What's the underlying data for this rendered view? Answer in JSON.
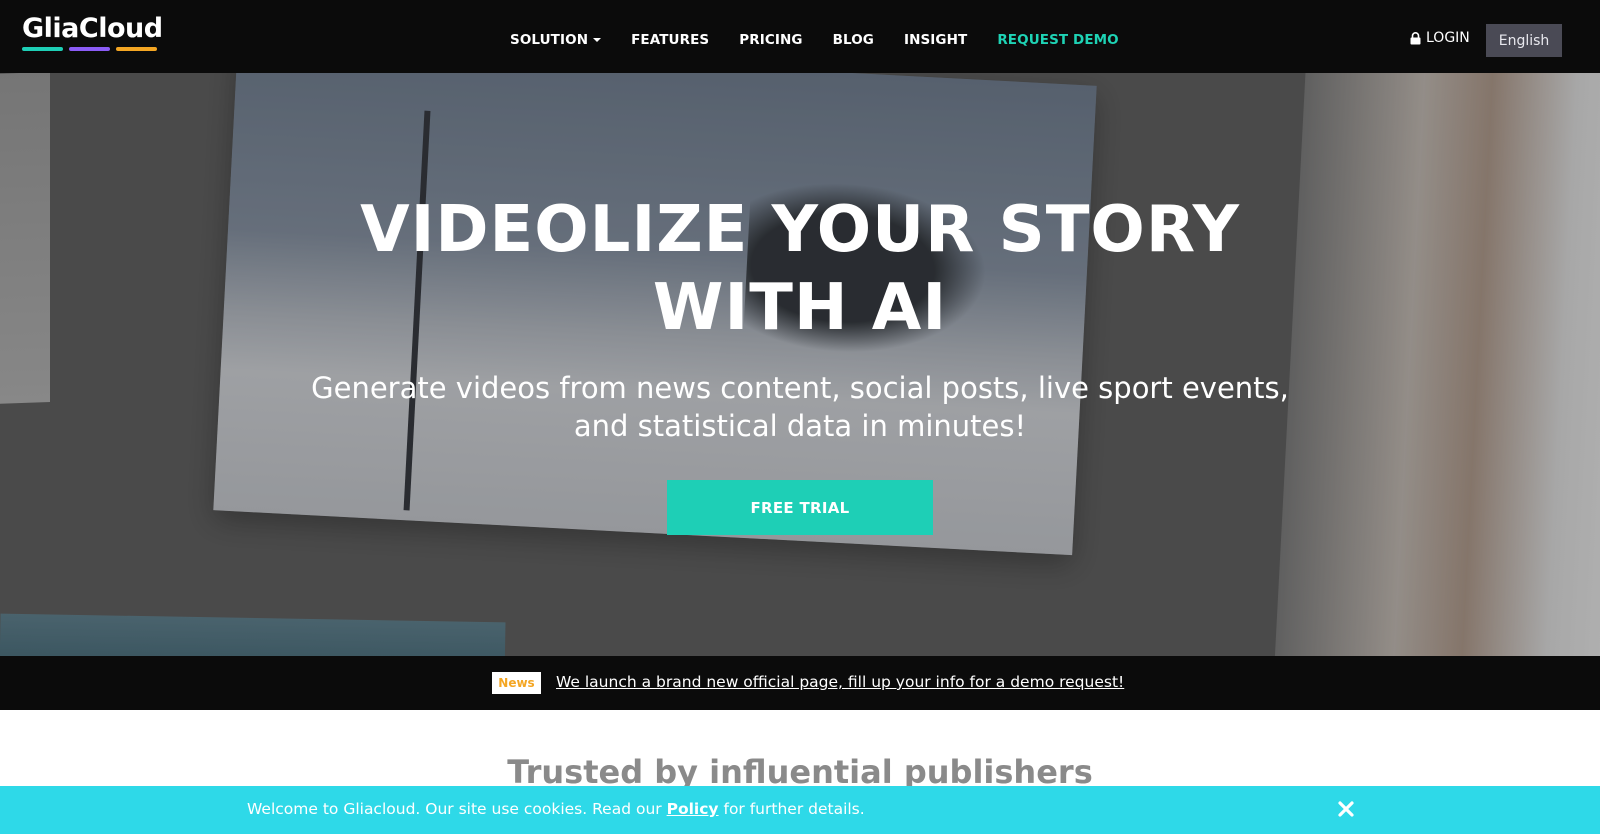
{
  "brand": {
    "name": "GliaCloud",
    "bar_colors": [
      "#1ecfb6",
      "#8b5cf6",
      "#f4a623"
    ]
  },
  "nav": {
    "items": [
      {
        "label": "SOLUTION",
        "has_dropdown": true
      },
      {
        "label": "FEATURES"
      },
      {
        "label": "PRICING"
      },
      {
        "label": "BLOG"
      },
      {
        "label": "INSIGHT"
      },
      {
        "label": "REQUEST DEMO",
        "accent": "#1ed3b5"
      }
    ],
    "login_label": "LOGIN",
    "language": "English"
  },
  "hero": {
    "title_line1": "VIDEOLIZE YOUR STORY",
    "title_line2": "WITH AI",
    "subtitle_line1": "Generate videos from news content, social posts, live sport events,",
    "subtitle_line2": "and statistical data in minutes!",
    "cta_label": "FREE TRIAL"
  },
  "news": {
    "badge": "News",
    "text": "We launch a brand new official page, fill up your info for a demo request!"
  },
  "trusted": {
    "heading": "Trusted by influential publishers"
  },
  "cookie": {
    "text_before": "Welcome to Gliacloud. Our site use cookies. Read our",
    "policy_link": "Policy",
    "text_after": "for further details."
  },
  "colors": {
    "header_bg": "#0b0b0b",
    "accent": "#1ecfb6",
    "cookie_bg": "#2ed9e8",
    "news_badge_text": "#f4a623"
  },
  "icons": [
    "lock-icon",
    "caret-down-icon",
    "close-icon"
  ]
}
